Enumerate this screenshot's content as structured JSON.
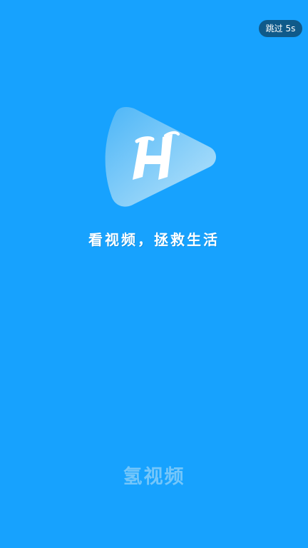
{
  "skip_button": {
    "label": "跳过 5s"
  },
  "logo": {
    "icon": "play-h-logo-icon",
    "accent": "#9ED4F7"
  },
  "slogan": "看视频，拯救生活",
  "brand_name": "氢视频",
  "colors": {
    "background": "#17A2FE",
    "skip_bg": "#0F5A8A",
    "brand_text": "#7FCBFA"
  }
}
